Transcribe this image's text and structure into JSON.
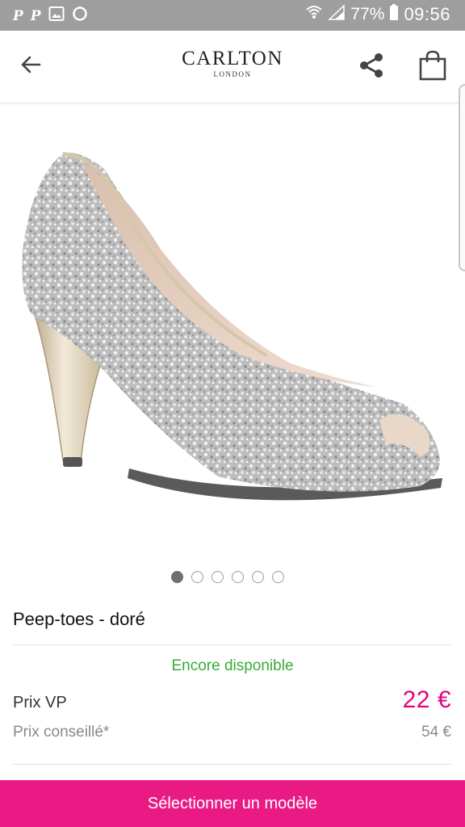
{
  "status_bar": {
    "left_icons": [
      "pinterest-icon",
      "pinterest-icon",
      "image-icon",
      "circle-icon"
    ],
    "p1": "P",
    "p2": "P",
    "battery": "77%",
    "time": "09:56"
  },
  "header": {
    "brand_name": "CARLTON",
    "brand_sub": "LONDON",
    "icons": [
      "back-arrow-icon",
      "share-icon",
      "shopping-bag-icon"
    ]
  },
  "carousel": {
    "count": 6,
    "active_index": 0
  },
  "product": {
    "title": "Peep-toes - doré",
    "availability": "Encore disponible",
    "price_vp_label": "Prix VP",
    "price_vp_value": "22 €",
    "price_rrp_label": "Prix conseillé*",
    "price_rrp_value": "54 €"
  },
  "cta": {
    "label": "Sélectionner un modèle"
  },
  "colors": {
    "accent": "#ea1a85",
    "price": "#e6007e",
    "available": "#3aaa35",
    "status_bar": "#9e9e9e"
  }
}
